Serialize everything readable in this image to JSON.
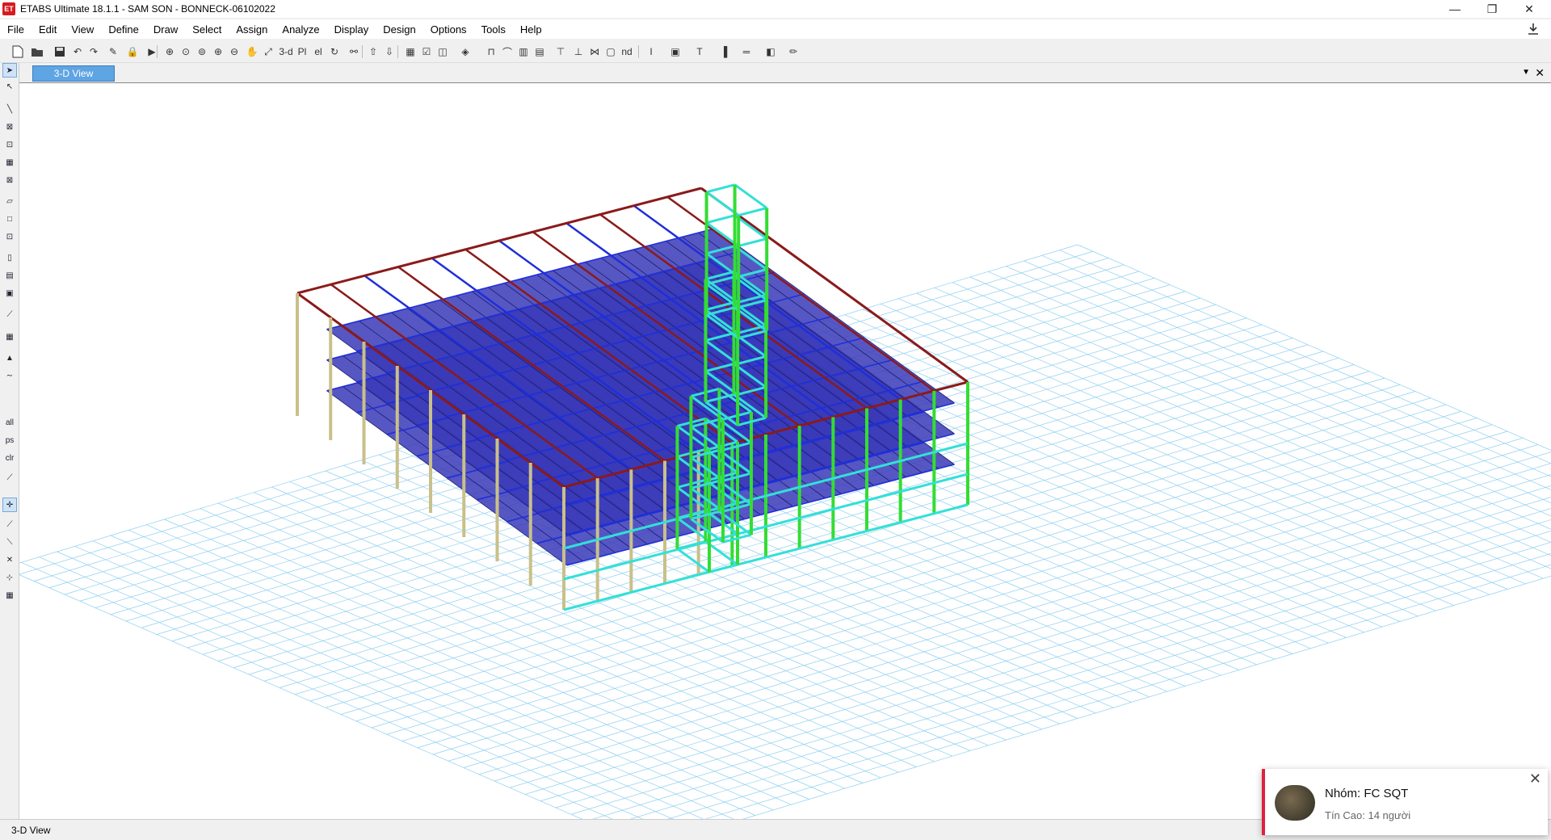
{
  "window": {
    "app_icon_text": "ET",
    "title": "ETABS Ultimate 18.1.1 - SAM SON - BONNECK-06102022",
    "minimize": "—",
    "restore": "❐",
    "close": "✕"
  },
  "menu": [
    "File",
    "Edit",
    "View",
    "Define",
    "Draw",
    "Select",
    "Assign",
    "Analyze",
    "Display",
    "Design",
    "Options",
    "Tools",
    "Help"
  ],
  "toolbar": {
    "view_3d_label": "3-d",
    "plan_label": "Pl",
    "elev_label": "el",
    "nd_label": "nd"
  },
  "left_toolbar": {
    "all_label": "all",
    "ps_label": "ps",
    "clr_label": "clr"
  },
  "tabs": {
    "active": "3-D View"
  },
  "status": {
    "text": "3-D View"
  },
  "notification": {
    "title": "Nhóm: FC SQT",
    "subtitle": "Tín Cao: 14 người"
  },
  "colors": {
    "beam_red": "#8b1a1a",
    "beam_blue": "#1f2fd8",
    "slab_blue": "#3a3ab8",
    "column_tan": "#c9c08a",
    "frame_green": "#33dd33",
    "frame_cyan": "#33e0d8",
    "grid": "#8ecff0",
    "tab_blue": "#5fa4e3"
  }
}
